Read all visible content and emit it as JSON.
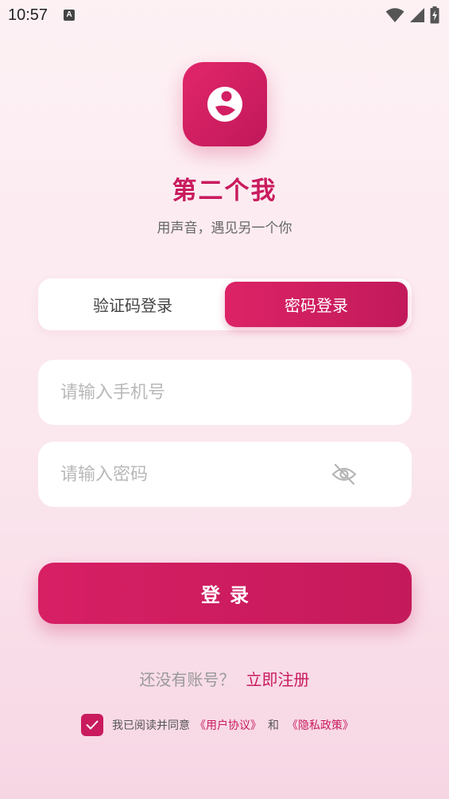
{
  "status_bar": {
    "time": "10:57",
    "notification_glyph": "A",
    "icons": [
      "wifi-icon",
      "cellular-signal-icon",
      "battery-charging-icon"
    ]
  },
  "app": {
    "name": "第二个我",
    "slogan": "用声音，遇见另一个你",
    "logo_icon": "face-logo-icon"
  },
  "tabs": [
    {
      "label": "验证码登录",
      "active": false
    },
    {
      "label": "密码登录",
      "active": true
    }
  ],
  "form": {
    "phone_placeholder": "请输入手机号",
    "phone_value": "",
    "password_placeholder": "请输入密码",
    "password_value": "",
    "password_toggle_icon": "eye-off-icon"
  },
  "login_button": {
    "label": "登录"
  },
  "register": {
    "prompt": "还没有账号？",
    "link": "立即注册"
  },
  "agreement": {
    "checked": true,
    "text": "我已阅读并同意",
    "user_agreement": "《用户协议》",
    "and": "和",
    "privacy_policy": "《隐私政策》"
  },
  "colors": {
    "accent": "#c91b5e",
    "accent_light": "#e2266a",
    "background_top": "#fdf1f4",
    "background_bottom": "#f7d6e4"
  }
}
